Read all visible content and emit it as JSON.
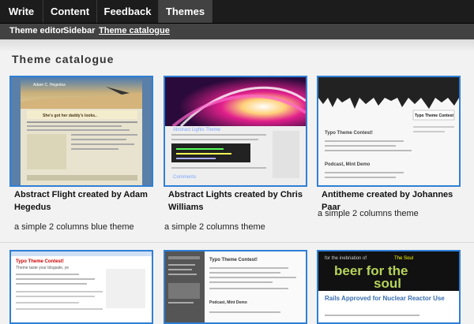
{
  "nav": {
    "tabs": [
      {
        "label": "Write"
      },
      {
        "label": "Content"
      },
      {
        "label": "Feedback"
      },
      {
        "label": "Themes",
        "active": true
      }
    ],
    "subtabs": [
      {
        "label": "Theme editor"
      },
      {
        "label": "Sidebar"
      },
      {
        "label": "Theme catalogue",
        "active": true
      }
    ]
  },
  "page": {
    "title": "Theme catalogue"
  },
  "themes": [
    {
      "title": "Abstract Flight created by Adam Hegedus",
      "description": "a simple 2 columns blue theme",
      "preview": {
        "header": "Adam C. Hegedus",
        "post_title": "She's got her daddy's looks.."
      }
    },
    {
      "title": "Abstract Lights created by Chris Williams",
      "description": "a simple 2 columns theme",
      "preview": {
        "header": "Abstract Lights Theme",
        "comments": "Comments"
      }
    },
    {
      "title": "Antitheme created by Johannes Paar",
      "description": "a simple 2 columns theme",
      "preview": {
        "header": "Typo Theme Contest",
        "post_title": "Typo Theme Contest!",
        "subtitle": "Podcast, Mint Demo"
      }
    },
    {
      "preview": {
        "header": "Typo Theme Contest!",
        "tagline": "Theme taste your blogsale, ye"
      }
    },
    {
      "preview": {
        "header": "Typo Theme Contest!",
        "subtitle": "Podcast, Mint Demo"
      }
    },
    {
      "preview": {
        "tagline": "for the inebriation of",
        "tagline_tag": "The Soul",
        "headline": "beer for the",
        "headline2": "soul",
        "post_title": "Rails Approved for Nuclear Reactor Use"
      }
    }
  ]
}
